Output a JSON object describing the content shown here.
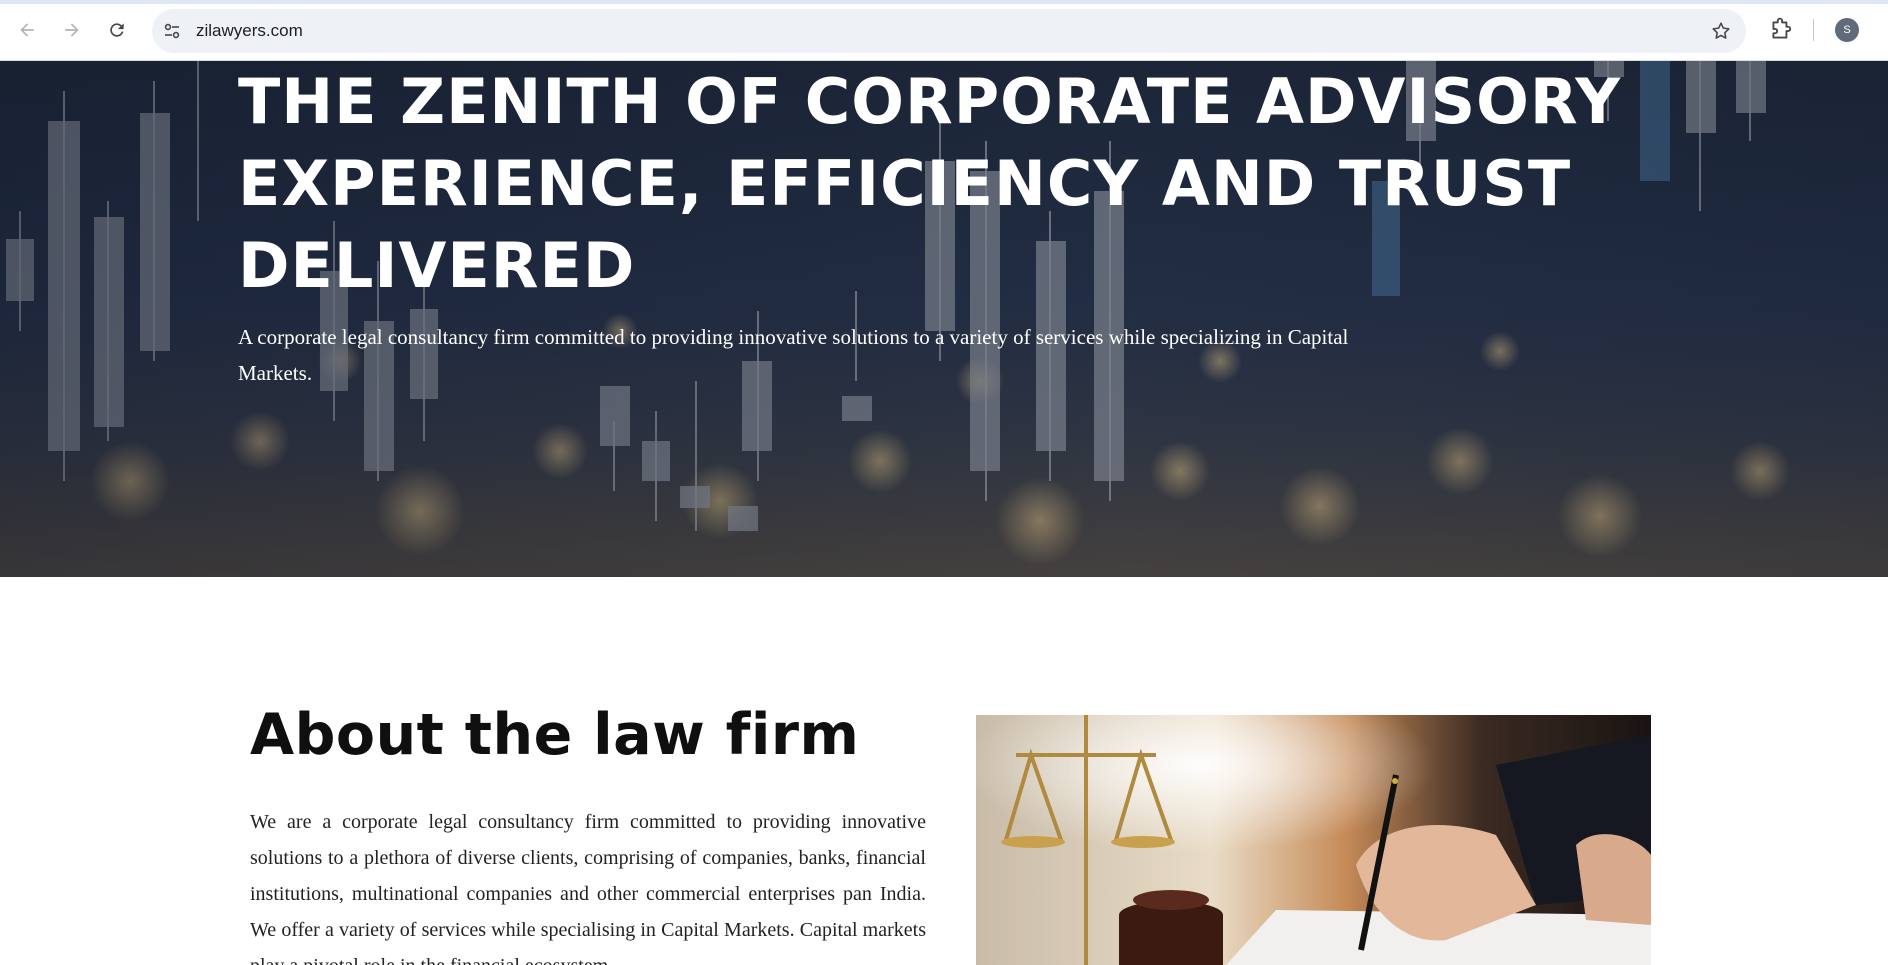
{
  "browser": {
    "url": "zilawyers.com",
    "avatar_initial": "S"
  },
  "hero": {
    "title_lines": [
      "THE ZENITH OF CORPORATE ADVISORY",
      "EXPERIENCE, EFFICIENCY AND TRUST",
      "DELIVERED"
    ],
    "subtitle": "A corporate legal consultancy firm committed to providing innovative solutions to a variety of services while specializing in Capital Markets."
  },
  "about": {
    "title": "About the law firm",
    "body": "We are a corporate legal consultancy firm committed to providing innovative solutions to a plethora of diverse clients, comprising of companies, banks, financial institutions, multinational companies and other commercial enterprises pan India. We offer a variety of services while specialising in Capital Markets. Capital markets play a pivotal role in the financial ecosystem"
  },
  "colors": {
    "hero_overlay": "#1f2a3c",
    "text_dark": "#0f0f0f",
    "omnibox_bg": "#eef1f6"
  },
  "icons": [
    "back-arrow-icon",
    "forward-arrow-icon",
    "reload-icon",
    "site-settings-icon",
    "bookmark-star-icon",
    "extensions-icon",
    "profile-avatar"
  ]
}
